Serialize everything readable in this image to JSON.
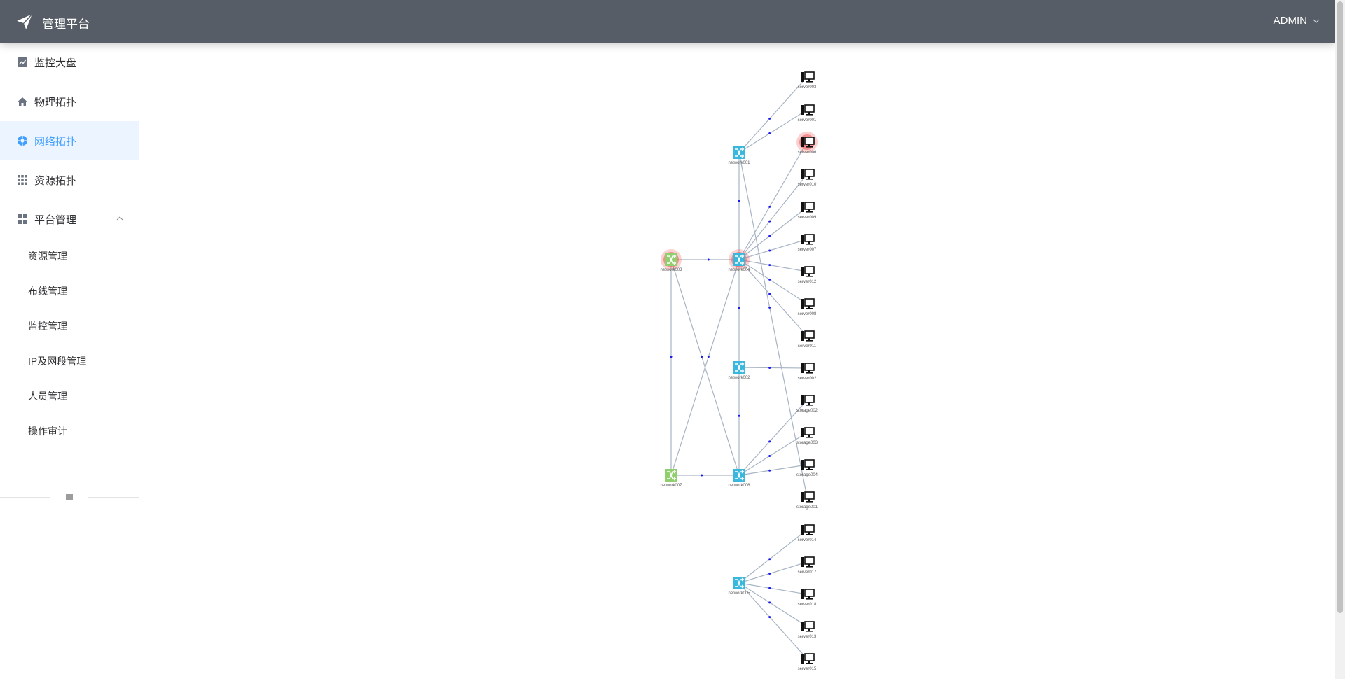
{
  "header": {
    "title": "管理平台",
    "logo_icon": "paper-plane-icon",
    "user": "ADMIN"
  },
  "sidebar": {
    "items": [
      {
        "label": "监控大盘",
        "icon": "line-chart-icon",
        "active": false
      },
      {
        "label": "物理拓扑",
        "icon": "home-icon",
        "active": false
      },
      {
        "label": "网络拓扑",
        "icon": "network-circle-icon",
        "active": true
      },
      {
        "label": "资源拓扑",
        "icon": "grid-icon",
        "active": false
      },
      {
        "label": "平台管理",
        "icon": "dashboard-icon",
        "active": false,
        "expanded": true
      }
    ],
    "sub_items": [
      "资源管理",
      "布线管理",
      "监控管理",
      "IP及网段管理",
      "人员管理",
      "操作审计"
    ]
  },
  "colors": {
    "header_bg": "#565d66",
    "active_text": "#409eff",
    "active_bg": "#ecf5ff",
    "switch_blue": "#3ab7dc",
    "switch_green": "#8fcf6e",
    "alarm_red": "#f05a5a",
    "edge": "#a7b4c4",
    "edge_dot": "#1a1aee"
  },
  "topology": {
    "nodes": [
      {
        "id": "network001",
        "type": "switch",
        "color": "blue",
        "alarm": false
      },
      {
        "id": "network002",
        "type": "switch",
        "color": "blue",
        "alarm": false
      },
      {
        "id": "network003",
        "type": "switch",
        "color": "green",
        "alarm": true
      },
      {
        "id": "network004",
        "type": "switch",
        "color": "blue",
        "alarm": true
      },
      {
        "id": "network005",
        "type": "switch",
        "color": "blue",
        "alarm": false
      },
      {
        "id": "network006",
        "type": "switch",
        "color": "blue",
        "alarm": false
      },
      {
        "id": "network007",
        "type": "switch",
        "color": "green",
        "alarm": false
      },
      {
        "id": "server003",
        "type": "server",
        "alarm": false
      },
      {
        "id": "server001",
        "type": "server",
        "alarm": false
      },
      {
        "id": "server006",
        "type": "server",
        "alarm": true
      },
      {
        "id": "server010",
        "type": "server",
        "alarm": false
      },
      {
        "id": "server009",
        "type": "server",
        "alarm": false
      },
      {
        "id": "server007",
        "type": "server",
        "alarm": false
      },
      {
        "id": "server012",
        "type": "server",
        "alarm": false
      },
      {
        "id": "server008",
        "type": "server",
        "alarm": false
      },
      {
        "id": "server011",
        "type": "server",
        "alarm": false
      },
      {
        "id": "server002",
        "type": "server",
        "alarm": false
      },
      {
        "id": "storage002",
        "type": "server",
        "alarm": false
      },
      {
        "id": "storage003",
        "type": "server",
        "alarm": false
      },
      {
        "id": "storage004",
        "type": "server",
        "alarm": false
      },
      {
        "id": "storage001",
        "type": "server",
        "alarm": false
      },
      {
        "id": "server014",
        "type": "server",
        "alarm": false
      },
      {
        "id": "server017",
        "type": "server",
        "alarm": false
      },
      {
        "id": "server018",
        "type": "server",
        "alarm": false
      },
      {
        "id": "server013",
        "type": "server",
        "alarm": false
      },
      {
        "id": "server015",
        "type": "server",
        "alarm": false
      }
    ],
    "edges": [
      [
        "network001",
        "server003"
      ],
      [
        "network001",
        "server001"
      ],
      [
        "network001",
        "network004"
      ],
      [
        "network001",
        "storage001"
      ],
      [
        "network004",
        "network003"
      ],
      [
        "network004",
        "server006"
      ],
      [
        "network004",
        "server010"
      ],
      [
        "network004",
        "server009"
      ],
      [
        "network004",
        "server007"
      ],
      [
        "network004",
        "server012"
      ],
      [
        "network004",
        "server008"
      ],
      [
        "network004",
        "server011"
      ],
      [
        "network004",
        "network002"
      ],
      [
        "network004",
        "network007"
      ],
      [
        "network003",
        "network007"
      ],
      [
        "network003",
        "network006"
      ],
      [
        "network002",
        "server002"
      ],
      [
        "network002",
        "network006"
      ],
      [
        "network007",
        "network006"
      ],
      [
        "network006",
        "storage002"
      ],
      [
        "network006",
        "storage003"
      ],
      [
        "network006",
        "storage004"
      ],
      [
        "network005",
        "server014"
      ],
      [
        "network005",
        "server017"
      ],
      [
        "network005",
        "server018"
      ],
      [
        "network005",
        "server013"
      ],
      [
        "network005",
        "server015"
      ]
    ]
  }
}
